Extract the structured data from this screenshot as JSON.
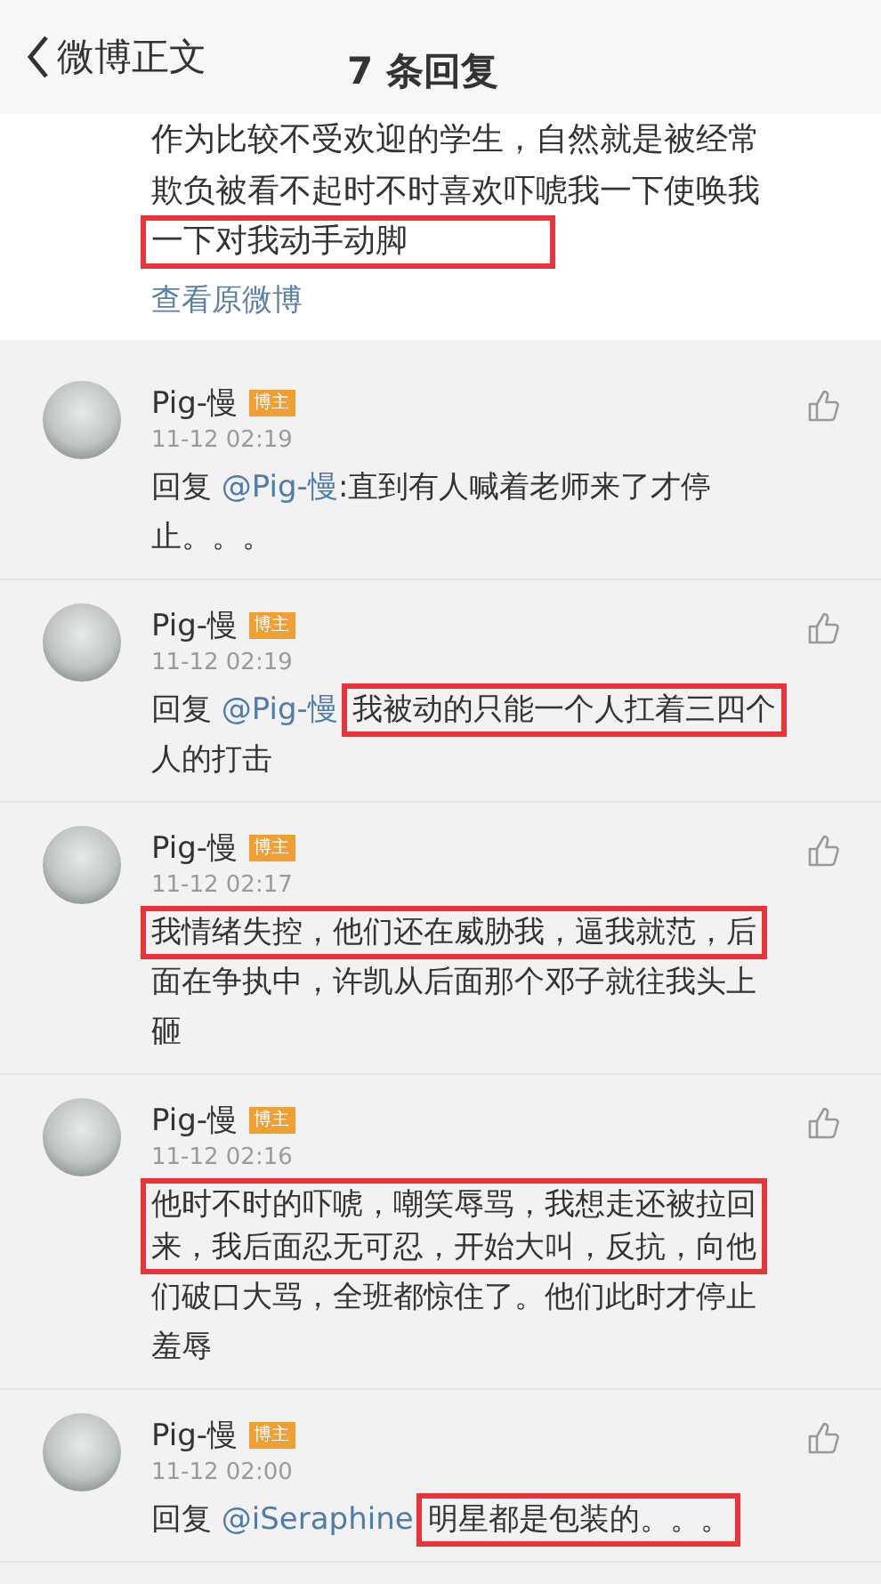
{
  "header": {
    "back_label": "微博正文",
    "title": "7 条回复"
  },
  "post": {
    "lines": [
      [
        {
          "kind": "plain",
          "text": "作为比较不受欢迎的学生，自然就是被经常"
        }
      ],
      [
        {
          "kind": "plain",
          "text": "欺负被看不起时不时喜欢吓唬我一下使唤我"
        }
      ],
      [
        {
          "kind": "marked",
          "lines": [
            "一下对我动手动脚"
          ]
        }
      ]
    ],
    "link": "查看原微博"
  },
  "comments": [
    {
      "name": "Pig-慢",
      "badge": "博主",
      "time": "11-12 02:19",
      "lines": [
        [
          {
            "kind": "plain",
            "text": "回复 "
          },
          {
            "kind": "mention",
            "text": "@Pig-慢"
          },
          {
            "kind": "plain",
            "text": ":直到有人喊着老师来了才停"
          }
        ],
        [
          {
            "kind": "plain",
            "text": "止。。。"
          }
        ]
      ]
    },
    {
      "name": "Pig-慢",
      "badge": "博主",
      "time": "11-12 02:19",
      "lines": [
        [
          {
            "kind": "plain",
            "text": "回复 "
          },
          {
            "kind": "mention",
            "text": "@Pig-慢"
          },
          {
            "kind": "marked",
            "lines": [
              "我被动的只能一个人扛着三四个"
            ]
          }
        ],
        [
          {
            "kind": "plain",
            "text": "人的打击"
          }
        ]
      ]
    },
    {
      "name": "Pig-慢",
      "badge": "博主",
      "time": "11-12 02:17",
      "lines": [
        [
          {
            "kind": "marked",
            "lines": [
              "我情绪失控，他们还在威胁我，逼我就范，后"
            ]
          }
        ],
        [
          {
            "kind": "plain",
            "text": "面在争执中，许凯从后面那个邓子就往我头上"
          }
        ],
        [
          {
            "kind": "plain",
            "text": "砸"
          }
        ]
      ]
    },
    {
      "name": "Pig-慢",
      "badge": "博主",
      "time": "11-12 02:16",
      "lines": [
        [
          {
            "kind": "marked",
            "lines": [
              "他时不时的吓唬，嘲笑辱骂，我想走还被拉回",
              "来，我后面忍无可忍，开始大叫，反抗，向他"
            ]
          }
        ],
        [
          {
            "kind": "plain",
            "text": "们破口大骂，全班都惊住了。他们此时才停止"
          }
        ],
        [
          {
            "kind": "plain",
            "text": "羞辱"
          }
        ]
      ]
    },
    {
      "name": "Pig-慢",
      "badge": "博主",
      "time": "11-12 02:00",
      "lines": [
        [
          {
            "kind": "plain",
            "text": "回复 "
          },
          {
            "kind": "mention",
            "text": "@iSeraphine"
          },
          {
            "kind": "marked",
            "lines": [
              "明星都是包装的。。。"
            ]
          }
        ]
      ]
    }
  ]
}
